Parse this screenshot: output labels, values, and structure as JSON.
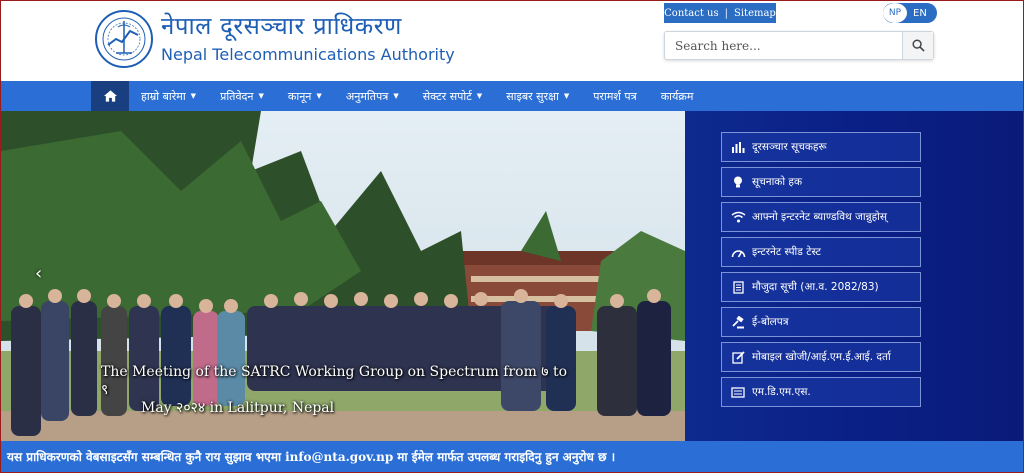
{
  "header": {
    "title_np": "नेपाल दूरसञ्चार प्राधिकरण",
    "title_en": "Nepal Telecommunications Authority",
    "top_links": {
      "contact": "Contact us",
      "sitemap": "Sitemap",
      "separator": "|"
    },
    "lang": {
      "np": "NP",
      "en": "EN"
    },
    "search": {
      "placeholder": "Search here..."
    }
  },
  "nav": {
    "items": [
      {
        "label": "हाम्रो बारेमा",
        "dropdown": true
      },
      {
        "label": "प्रतिवेदन",
        "dropdown": true
      },
      {
        "label": "कानून",
        "dropdown": true
      },
      {
        "label": "अनुमतिपत्र",
        "dropdown": true
      },
      {
        "label": "सेक्टर सपोर्ट",
        "dropdown": true
      },
      {
        "label": "साइबर सुरक्षा",
        "dropdown": true
      },
      {
        "label": "परामर्श पत्र",
        "dropdown": false
      },
      {
        "label": "कार्यक्रम",
        "dropdown": false
      }
    ]
  },
  "slider": {
    "caption_line1": "The Meeting of the SATRC Working Group on Spectrum from ७ to ९",
    "caption_line2": "May २०२४ in Lalitpur, Nepal"
  },
  "quick_links": [
    {
      "label": "दूरसञ्चार सूचकहरू",
      "icon": "bar-chart-icon"
    },
    {
      "label": "सूचनाको हक",
      "icon": "lightbulb-icon"
    },
    {
      "label": "आफ्नो इन्टरनेट ब्याण्डविथ जान्नुहोस्",
      "icon": "wifi-icon"
    },
    {
      "label": "इन्टरनेट स्पीड टेस्ट",
      "icon": "speedometer-icon"
    },
    {
      "label": "मौजुदा सूची (आ.व. 2082/83)",
      "icon": "document-icon"
    },
    {
      "label": "ई-बोलपत्र",
      "icon": "gavel-icon"
    },
    {
      "label": "मोबाइल खोजी/आई.एम.ई.आई. दर्ता",
      "icon": "edit-icon"
    },
    {
      "label": "एम.डि.एम.एस.",
      "icon": "list-card-icon"
    }
  ],
  "notice": {
    "text_before": "यस प्राधिकरणको वेबसाइटसँग सम्बन्धित कुनै राय सुझाव भएमा",
    "email": "info@nta.gov.np",
    "text_after": "मा ईमेल मार्फत उपलब्ध गराइदिनु हुन अनुरोध छ ।"
  },
  "colors": {
    "brand_blue": "#2b6fd6",
    "dark_blue": "#0a1f86",
    "title_blue": "#1e5fb5"
  }
}
